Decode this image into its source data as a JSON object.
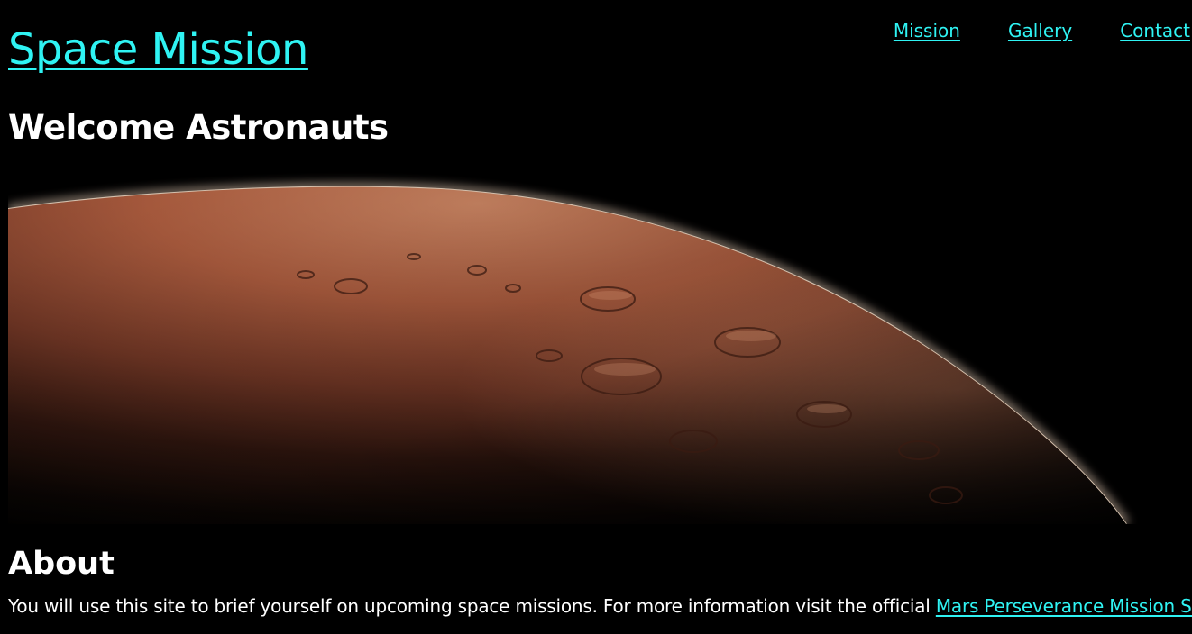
{
  "header": {
    "site_title": "Space Mission",
    "nav": [
      {
        "label": "Mission"
      },
      {
        "label": "Gallery"
      },
      {
        "label": "Contact"
      }
    ]
  },
  "main": {
    "welcome_heading": "Welcome Astronauts",
    "hero_image_alt": "Mars horizon",
    "about": {
      "heading": "About",
      "text": "You will use this site to brief yourself on upcoming space missions. For more information visit the official ",
      "link_label": "Mars Perseverance Mission Site"
    }
  },
  "colors": {
    "background": "#000000",
    "link": "#2ff3f3",
    "text": "#ffffff",
    "planet": "#b86a4c"
  }
}
